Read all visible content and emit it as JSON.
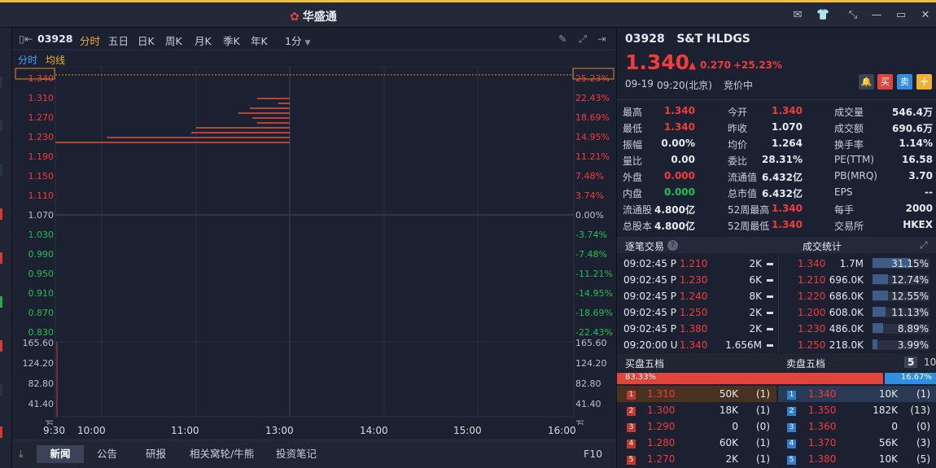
{
  "app": {
    "title": "华盛通"
  },
  "colors": {
    "up": "#f23b3b",
    "down": "#1fbf55",
    "accent": "#f0c040",
    "volbar": "#3d5c86"
  },
  "toolbar": {
    "code": "03928",
    "periods": [
      "分时",
      "五日",
      "日K",
      "周K",
      "月K",
      "季K",
      "年K"
    ],
    "interval": "1分",
    "active_period": "分时"
  },
  "ma": {
    "l1": "分时",
    "l2": "均线"
  },
  "chart_data": {
    "type": "line",
    "title": "",
    "x_ticks": [
      "9:30",
      "10:00",
      "11:00",
      "13:00",
      "14:00",
      "15:00",
      "16:00"
    ],
    "price_axis": [
      "1.340",
      "1.310",
      "1.270",
      "1.230",
      "1.190",
      "1.150",
      "1.110",
      "1.070",
      "1.030",
      "0.990",
      "0.950",
      "0.910",
      "0.870",
      "0.830"
    ],
    "pct_axis": [
      "25.23%",
      "22.43%",
      "18.69%",
      "14.95%",
      "11.21%",
      "7.48%",
      "3.74%",
      "0.00%",
      "-3.74%",
      "-7.48%",
      "-11.21%",
      "-14.95%",
      "-18.69%",
      "-22.43%"
    ],
    "volume_axis": [
      "165.60",
      "124.20",
      "82.80",
      "41.40",
      "万"
    ],
    "prev_close": 1.07,
    "current": 1.34,
    "ylim": [
      0.81,
      1.35
    ],
    "order_depth_levels": [
      {
        "price": 1.31,
        "rel": 0.14
      },
      {
        "price": 1.3,
        "rel": 0.05
      },
      {
        "price": 1.29,
        "rel": 0.17
      },
      {
        "price": 1.28,
        "rel": 0.22
      },
      {
        "price": 1.27,
        "rel": 0.16
      },
      {
        "price": 1.26,
        "rel": 0.14
      },
      {
        "price": 1.25,
        "rel": 0.4
      },
      {
        "price": 1.24,
        "rel": 0.42
      },
      {
        "price": 1.23,
        "rel": 0.78
      },
      {
        "price": 1.22,
        "rel": 1.0
      }
    ]
  },
  "bottom_tabs": [
    "新闻",
    "公告",
    "研报",
    "相关窝轮/牛熊",
    "投资笔记"
  ],
  "bottom_right": "F10",
  "stock": {
    "code": "03928",
    "name": "S&T HLDGS",
    "price": "1.340",
    "change": "0.270",
    "change_pct": "+25.23%",
    "date": "09-19",
    "time": "09:20(北京)",
    "status": "竞价中"
  },
  "actions": {
    "buy": "买",
    "sell": "卖",
    "add": "+"
  },
  "quote_rows": [
    [
      [
        "最高",
        "1.340",
        "r"
      ],
      [
        "今开",
        "1.340",
        "r"
      ],
      [
        "成交量",
        "546.4万",
        "w"
      ]
    ],
    [
      [
        "最低",
        "1.340",
        "r"
      ],
      [
        "昨收",
        "1.070",
        "w"
      ],
      [
        "成交额",
        "690.6万",
        "w"
      ]
    ],
    [
      [
        "振幅",
        "0.00%",
        "w"
      ],
      [
        "均价",
        "1.264",
        "w"
      ],
      [
        "换手率",
        "1.14%",
        "w"
      ]
    ],
    [
      [
        "量比",
        "0.00",
        "w"
      ],
      [
        "委比",
        "28.31%",
        "w"
      ],
      [
        "PE(TTM)",
        "16.58",
        "w"
      ]
    ],
    [
      [
        "外盘",
        "0.000",
        "r"
      ],
      [
        "流通值",
        "6.432亿",
        "w"
      ],
      [
        "PB(MRQ)",
        "3.70",
        "w"
      ]
    ],
    [
      [
        "内盘",
        "0.000",
        "g"
      ],
      [
        "总市值",
        "6.432亿",
        "w"
      ],
      [
        "EPS",
        "--",
        "w"
      ]
    ],
    [
      [
        "流通股",
        "4.800亿",
        "w"
      ],
      [
        "52周最高",
        "1.340",
        "r"
      ],
      [
        "每手",
        "2000",
        "w"
      ]
    ],
    [
      [
        "总股本",
        "4.800亿",
        "w"
      ],
      [
        "52周最低",
        "1.340",
        "r"
      ],
      [
        "交易所",
        "HKEX",
        "w"
      ]
    ]
  ],
  "trades_header": {
    "left": "逐笔交易",
    "right": "成交统计"
  },
  "trades": [
    {
      "time": "09:02:45 P",
      "price": "1.210",
      "vol": "2K"
    },
    {
      "time": "09:02:45 P",
      "price": "1.230",
      "vol": "6K"
    },
    {
      "time": "09:02:45 P",
      "price": "1.240",
      "vol": "8K"
    },
    {
      "time": "09:02:45 P",
      "price": "1.250",
      "vol": "2K"
    },
    {
      "time": "09:02:45 P",
      "price": "1.380",
      "vol": "2K"
    },
    {
      "time": "09:20:00 U",
      "price": "1.340",
      "vol": "1.656M"
    }
  ],
  "stats": [
    {
      "price": "1.340",
      "vol": "1.7M",
      "pct": "31.15%",
      "frac": 0.3115
    },
    {
      "price": "1.210",
      "vol": "696.0K",
      "pct": "12.74%",
      "frac": 0.1274
    },
    {
      "price": "1.220",
      "vol": "686.0K",
      "pct": "12.55%",
      "frac": 0.1255
    },
    {
      "price": "1.200",
      "vol": "608.0K",
      "pct": "11.13%",
      "frac": 0.1113
    },
    {
      "price": "1.230",
      "vol": "486.0K",
      "pct": "8.89%",
      "frac": 0.0889
    },
    {
      "price": "1.250",
      "vol": "218.0K",
      "pct": "3.99%",
      "frac": 0.0399
    }
  ],
  "orderbook_header": {
    "bid": "买盘五档",
    "ask": "卖盘五档",
    "n5": "5",
    "n10": "10"
  },
  "ratio": {
    "bid": "83.33%",
    "ask": "16.67%",
    "bid_frac": 0.8333
  },
  "bids": [
    {
      "n": "1",
      "price": "1.310",
      "vol": "50K",
      "cnt": "(1)"
    },
    {
      "n": "2",
      "price": "1.300",
      "vol": "18K",
      "cnt": "(1)"
    },
    {
      "n": "3",
      "price": "1.290",
      "vol": "0",
      "cnt": "(0)"
    },
    {
      "n": "4",
      "price": "1.280",
      "vol": "60K",
      "cnt": "(1)"
    },
    {
      "n": "5",
      "price": "1.270",
      "vol": "2K",
      "cnt": "(1)"
    }
  ],
  "asks": [
    {
      "n": "1",
      "price": "1.340",
      "vol": "10K",
      "cnt": "(1)"
    },
    {
      "n": "2",
      "price": "1.350",
      "vol": "182K",
      "cnt": "(13)"
    },
    {
      "n": "3",
      "price": "1.360",
      "vol": "0",
      "cnt": "(0)"
    },
    {
      "n": "4",
      "price": "1.370",
      "vol": "56K",
      "cnt": "(3)"
    },
    {
      "n": "5",
      "price": "1.380",
      "vol": "10K",
      "cnt": "(5)"
    }
  ]
}
